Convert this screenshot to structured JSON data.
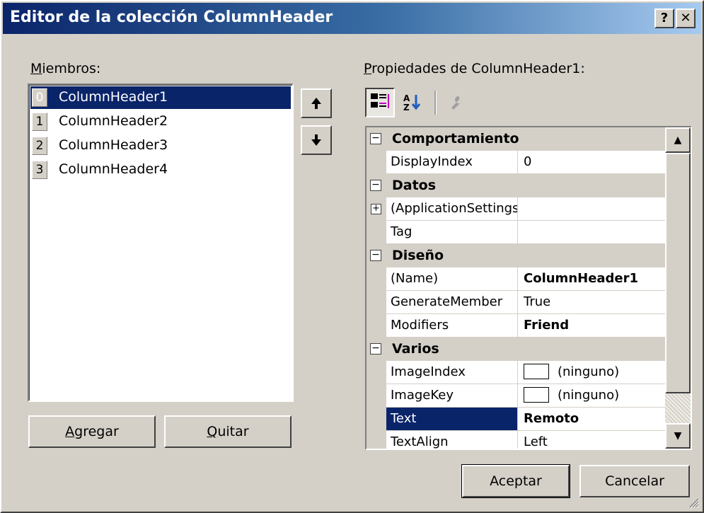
{
  "window": {
    "title": "Editor de la colección ColumnHeader",
    "help_label": "?",
    "close_label": "✕"
  },
  "members": {
    "label_mnemonic": "M",
    "label_rest": "iembros:",
    "items": [
      {
        "index": "0",
        "name": "ColumnHeader1"
      },
      {
        "index": "1",
        "name": "ColumnHeader2"
      },
      {
        "index": "2",
        "name": "ColumnHeader3"
      },
      {
        "index": "3",
        "name": "ColumnHeader4"
      }
    ],
    "selected_index": 0,
    "move_up_icon": "arrow-up-icon",
    "move_down_icon": "arrow-down-icon"
  },
  "buttons": {
    "add_mnemonic": "A",
    "add_rest": "gregar",
    "remove_mnemonic": "Q",
    "remove_rest": "uitar",
    "ok": "Aceptar",
    "cancel": "Cancelar"
  },
  "properties": {
    "label_mnemonic": "P",
    "label_rest": "ropiedades de ColumnHeader1:",
    "toolbar_icons": [
      "categorized-icon",
      "alphabetical-icon",
      "property-pages-icon"
    ],
    "categories": [
      {
        "name": "Comportamiento",
        "items": [
          {
            "name": "DisplayIndex",
            "value": "0",
            "bold": false
          }
        ]
      },
      {
        "name": "Datos",
        "items": [
          {
            "name": "(ApplicationSettings)",
            "value": "",
            "bold": false,
            "expandable": true
          },
          {
            "name": "Tag",
            "value": "",
            "bold": false
          }
        ]
      },
      {
        "name": "Diseño",
        "items": [
          {
            "name": "(Name)",
            "value": "ColumnHeader1",
            "bold": true
          },
          {
            "name": "GenerateMember",
            "value": "True",
            "bold": false
          },
          {
            "name": "Modifiers",
            "value": "Friend",
            "bold": true
          }
        ]
      },
      {
        "name": "Varios",
        "items": [
          {
            "name": "ImageIndex",
            "value": "(ninguno)",
            "bold": false,
            "swatch": true
          },
          {
            "name": "ImageKey",
            "value": "(ninguno)",
            "bold": false,
            "swatch": true
          },
          {
            "name": "Text",
            "value": "Remoto",
            "bold": true,
            "selected": true
          },
          {
            "name": "TextAlign",
            "value": "Left",
            "bold": false
          }
        ]
      }
    ]
  },
  "colors": {
    "selection": "#0a246a",
    "face": "#d4d0c8",
    "title_start": "#0a246a",
    "title_end": "#a6caf0"
  }
}
